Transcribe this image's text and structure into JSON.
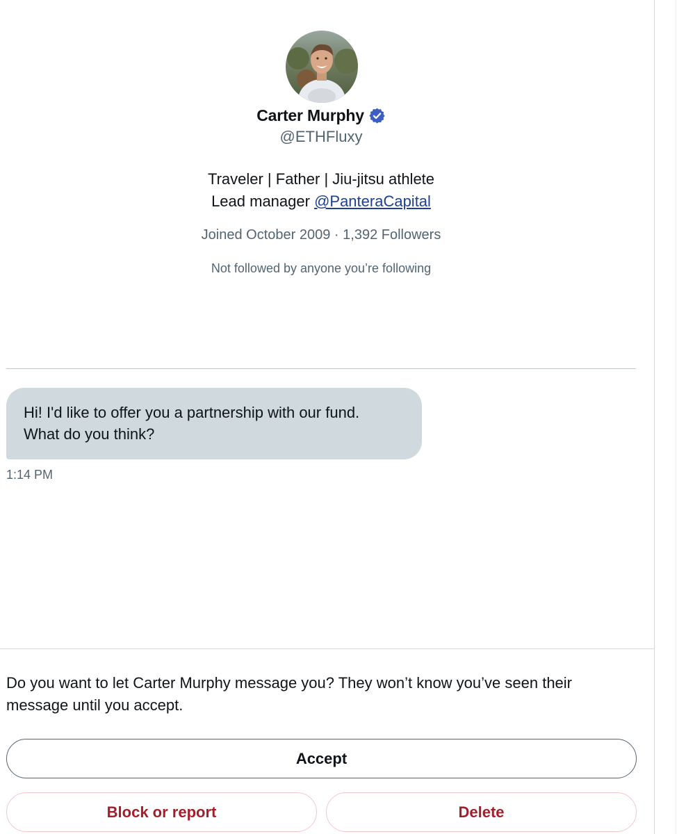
{
  "profile": {
    "name": "Carter Murphy",
    "handle": "@ETHFluxy",
    "bio_line1": "Traveler | Father | Jiu-jitsu athlete",
    "bio_line2_prefix": "Lead manager ",
    "bio_line2_link": "@PanteraCapital",
    "joined": "Joined October 2009",
    "separator": " · ",
    "followers": "1,392 Followers",
    "not_followed": "Not followed by anyone you’re following",
    "verified_icon": "verified-badge-icon",
    "accent_color": "#3b5fc4"
  },
  "message": {
    "line1": "Hi! I'd like to offer you a partnership with our fund.",
    "line2": "What do you think?",
    "time": "1:14 PM"
  },
  "request": {
    "prompt_line1": "Do you want to let Carter Murphy message you? They won’t know you’ve seen their",
    "prompt_line2": "message until you accept.",
    "accept_label": "Accept",
    "block_label": "Block or report",
    "delete_label": "Delete",
    "danger_color": "#a41f2b"
  }
}
